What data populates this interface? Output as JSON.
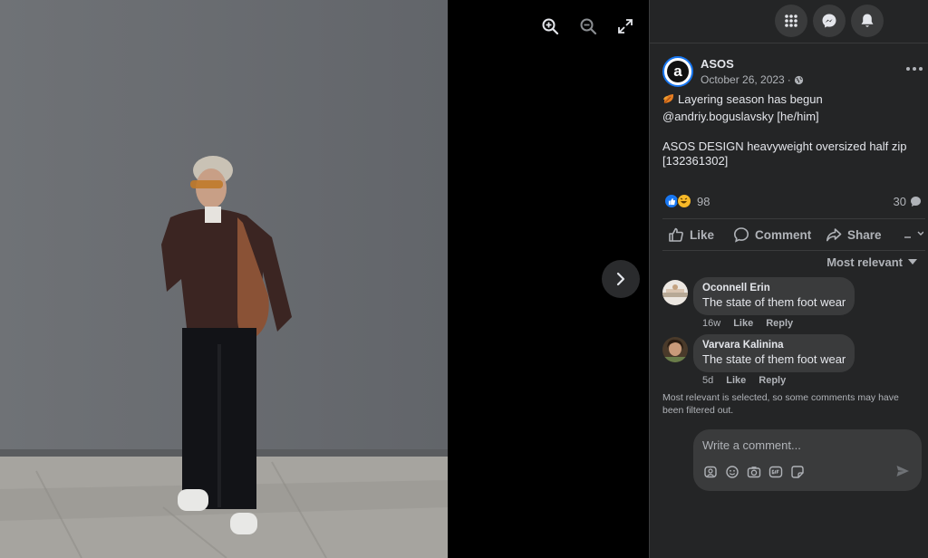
{
  "viewer": {
    "zoom_in_icon": "zoom-in-icon",
    "zoom_out_icon": "zoom-out-icon",
    "fullscreen_icon": "fullscreen-icon",
    "next_icon": "chevron-right-icon"
  },
  "topbar": {
    "menu_icon": "grid-menu-icon",
    "messenger_icon": "messenger-icon",
    "notifications_icon": "bell-icon"
  },
  "post": {
    "page_name": "ASOS",
    "page_avatar_letter": "a",
    "date": "October 26, 2023",
    "separator": "·",
    "audience_icon": "globe-icon",
    "caption_lines": [
      "Layering season has begun",
      "@andriy.boguslavsky [he/him]",
      "",
      "ASOS DESIGN heavyweight oversized half zip",
      "[132361302]"
    ],
    "caption_emoji": "leaf-icon",
    "reaction_count": "98",
    "comment_count": "30"
  },
  "actions": {
    "like": "Like",
    "comment": "Comment",
    "share": "Share"
  },
  "comments_section": {
    "sort_label": "Most relevant",
    "comments": [
      {
        "author": "Oconnell Erin",
        "text": "The state of them foot wear",
        "time": "16w",
        "like": "Like",
        "reply": "Reply"
      },
      {
        "author": "Varvara Kalinina",
        "text": "The state of them foot wear",
        "time": "5d",
        "like": "Like",
        "reply": "Reply"
      }
    ],
    "filter_note": "Most relevant is selected, so some comments may have been filtered out."
  },
  "composer": {
    "placeholder": "Write a comment...",
    "icons": [
      "avatar-sticker-icon",
      "emoji-icon",
      "camera-icon",
      "gif-icon",
      "sticker-icon"
    ],
    "send_icon": "send-icon"
  },
  "colors": {
    "sidebar_bg": "#242526",
    "bubble_bg": "#3a3b3c",
    "accent": "#1877f2",
    "primary_text": "#e4e6eb",
    "secondary_text": "#b0b3b8"
  }
}
